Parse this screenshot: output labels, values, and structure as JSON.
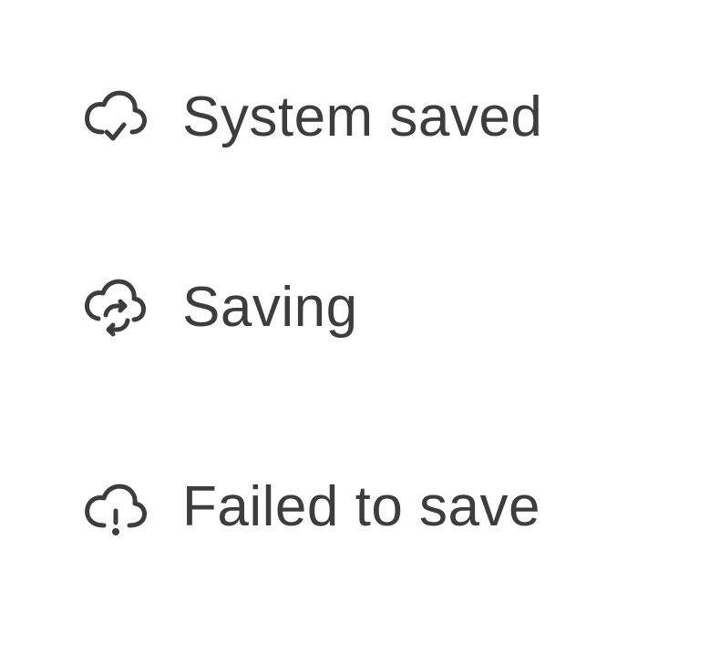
{
  "statuses": [
    {
      "label": "System saved",
      "icon": "cloud-check-icon"
    },
    {
      "label": "Saving",
      "icon": "cloud-sync-icon"
    },
    {
      "label": "Failed to save",
      "icon": "cloud-alert-icon"
    }
  ],
  "colors": {
    "text": "#3d3d3d",
    "background": "#ffffff"
  }
}
